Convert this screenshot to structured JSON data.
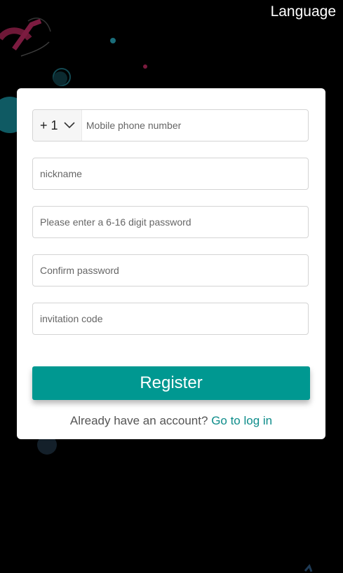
{
  "header": {
    "language_label": "Language"
  },
  "form": {
    "country_code": "+ 1",
    "phone_placeholder": "Mobile phone number",
    "nickname_placeholder": "nickname",
    "password_placeholder": "Please enter a 6-16 digit password",
    "confirm_placeholder": "Confirm password",
    "invite_placeholder": "invitation code",
    "register_label": "Register"
  },
  "footer": {
    "question": "Already have an account?",
    "login_link": "Go to log in"
  },
  "colors": {
    "accent": "#009891",
    "link": "#0d8c8a",
    "background": "#000000",
    "card": "#ffffff"
  }
}
